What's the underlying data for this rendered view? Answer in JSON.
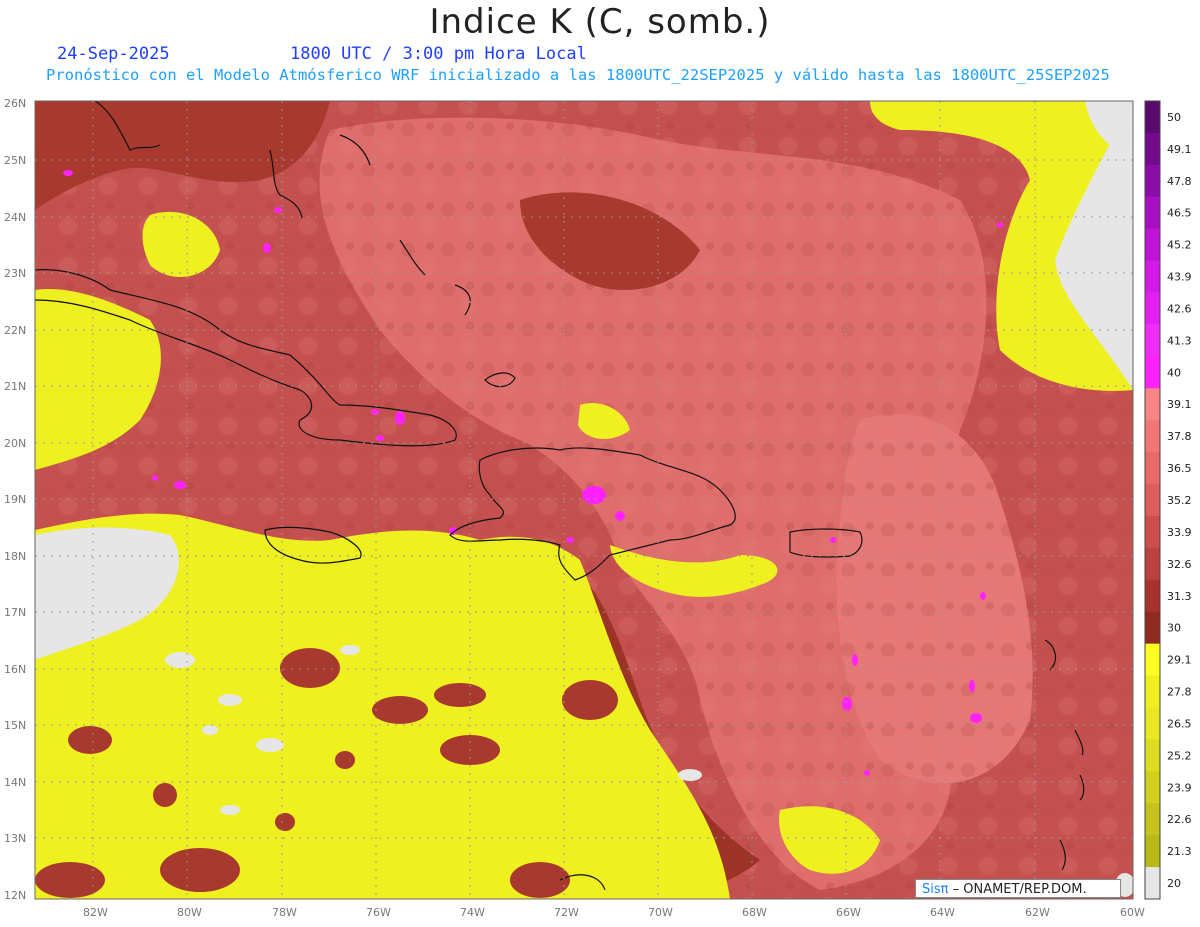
{
  "title": "Indice K (C, somb.)",
  "date": "24-Sep-2025",
  "time": "1800 UTC / 3:00 pm Hora Local",
  "subtitle": "Pronóstico con el Modelo Atmósferico WRF inicializado a las 1800UTC_22SEP2025 y válido hasta las  1800UTC_25SEP2025",
  "credit": {
    "logo": "Sisπ",
    "text": "– ONAMET/REP.DOM."
  },
  "lat_labels": [
    "26N",
    "25N",
    "24N",
    "23N",
    "22N",
    "21N",
    "20N",
    "19N",
    "18N",
    "17N",
    "16N",
    "15N",
    "14N",
    "13N",
    "12N"
  ],
  "lon_labels": [
    "82W",
    "80W",
    "78W",
    "76W",
    "74W",
    "72W",
    "70W",
    "68W",
    "66W",
    "64W",
    "62W",
    "60W"
  ],
  "colorbar": {
    "labels": [
      "50",
      "49.1",
      "47.8",
      "46.5",
      "45.2",
      "43.9",
      "42.6",
      "41.3",
      "40",
      "39.1",
      "37.8",
      "36.5",
      "35.2",
      "33.9",
      "32.6",
      "31.3",
      "30",
      "29.1",
      "27.8",
      "26.5",
      "25.2",
      "23.9",
      "22.6",
      "21.3",
      "20"
    ],
    "colors": [
      "#5a0a6e",
      "#730a8c",
      "#8c0ca8",
      "#a80fc4",
      "#bf14d8",
      "#d419e8",
      "#e41ff2",
      "#f02cf8",
      "#ff22ff",
      "#fa8585",
      "#f27675",
      "#e86a68",
      "#dd5e5d",
      "#cd4f4d",
      "#bd4140",
      "#a8322e",
      "#8f2a1f",
      "#ffff22",
      "#f0f020",
      "#e8e822",
      "#dcdc20",
      "#d0d01e",
      "#c4c41c",
      "#b9b91a",
      "#e6e6e6"
    ]
  }
}
